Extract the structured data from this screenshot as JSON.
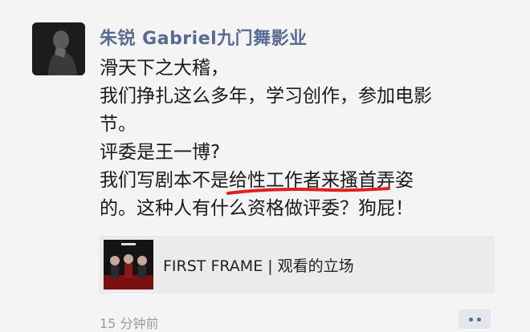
{
  "post": {
    "author": "朱锐 Gabriel九门舞影业",
    "content_lines": [
      "滑天下之大稽，",
      "我们挣扎这么多年，学习创作，参加电影",
      "节。",
      "评委是王一博?",
      "我们写剧本不是给性工作者来搔首弄姿",
      "的。这种人有什么资格做评委？狗屁！"
    ],
    "link_card": {
      "title": "FIRST FRAME | 观看的立场"
    },
    "timestamp": "15 分钟前"
  },
  "colors": {
    "author_name": "#576b95",
    "underline_annotation": "#e02020",
    "background": "#f4f4f4"
  },
  "icons": {
    "more": "ellipsis-icon"
  }
}
